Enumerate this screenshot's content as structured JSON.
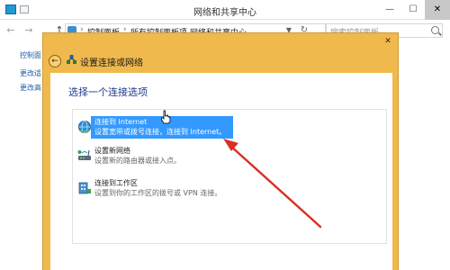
{
  "window": {
    "title": "网络和共享中心",
    "controls": {
      "minimize": "—",
      "maximize": "☐",
      "close": "✕"
    }
  },
  "address_bar": {
    "crumbs": [
      "控制面板",
      "所有控制面板项",
      "网络和共享中心"
    ],
    "separator": "›"
  },
  "search": {
    "placeholder": "搜索控制面板"
  },
  "sidebar": {
    "links": [
      "控制面",
      "更改适",
      "更改高"
    ]
  },
  "dialog": {
    "title": "设置连接或网络",
    "heading": "选择一个连接选项",
    "close": "✕",
    "options": [
      {
        "title": "连接到 Internet",
        "desc": "设置宽带或拨号连接，连接到 Internet。",
        "selected": true,
        "icon": "globe-icon"
      },
      {
        "title": "设置新网络",
        "desc": "设置新的路由器或接入点。",
        "selected": false,
        "icon": "network-setup-icon"
      },
      {
        "title": "连接到工作区",
        "desc": "设置到你的工作区的拨号或 VPN 连接。",
        "selected": false,
        "icon": "workplace-icon"
      }
    ]
  },
  "colors": {
    "dialog_frame": "#f0b94d",
    "selection": "#3399ff",
    "heading_text": "#1e3a8a",
    "annotation_arrow": "#d93025"
  }
}
